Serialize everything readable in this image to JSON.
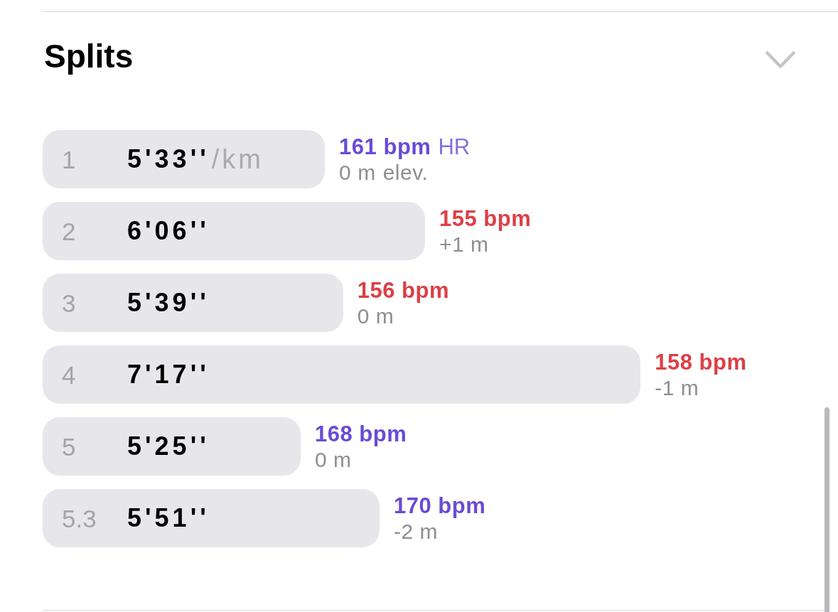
{
  "section": {
    "title": "Splits"
  },
  "splits": [
    {
      "index": "1",
      "pace": "5'33''",
      "pace_unit": "/km",
      "heart_rate": "161 bpm",
      "heart_rate_label": "HR",
      "elevation": "0 m",
      "elevation_label": "elev.",
      "color": "#6a4bd6"
    },
    {
      "index": "2",
      "pace": "6'06''",
      "heart_rate": "155 bpm",
      "elevation": "+1 m",
      "color": "#dc3f45"
    },
    {
      "index": "3",
      "pace": "5'39''",
      "heart_rate": "156 bpm",
      "elevation": "0 m",
      "color": "#dc3f45"
    },
    {
      "index": "4",
      "pace": "7'17''",
      "heart_rate": "158 bpm",
      "elevation": "-1 m",
      "color": "#dc3f45"
    },
    {
      "index": "5",
      "pace": "5'25''",
      "heart_rate": "168 bpm",
      "elevation": "0 m",
      "color": "#6a4bd6"
    },
    {
      "index": "5.3",
      "pace": "5'51''",
      "heart_rate": "170 bpm",
      "elevation": "-2 m",
      "color": "#6a4bd6"
    }
  ]
}
